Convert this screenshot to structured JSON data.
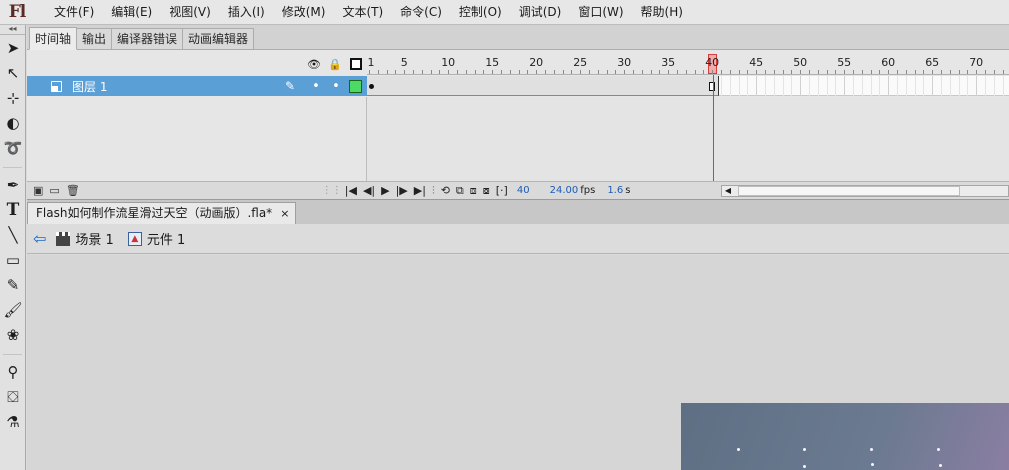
{
  "app": {
    "logo": "Fl"
  },
  "menu": [
    "文件(F)",
    "编辑(E)",
    "视图(V)",
    "插入(I)",
    "修改(M)",
    "文本(T)",
    "命令(C)",
    "控制(O)",
    "调试(D)",
    "窗口(W)",
    "帮助(H)"
  ],
  "toolbar": {
    "grip": "◂◂",
    "tools": [
      "selection-tool",
      "subselection-tool",
      "free-transform-tool",
      "3d-rotation-tool",
      "lasso-tool",
      "pen-tool",
      "text-tool",
      "line-tool",
      "rectangle-tool",
      "pencil-tool",
      "brush-tool",
      "deco-tool",
      "bone-tool",
      "paint-bucket-tool",
      "eyedropper-tool"
    ],
    "text_glyph": "T"
  },
  "timeline": {
    "tabs": [
      {
        "label": "时间轴",
        "active": true
      },
      {
        "label": "输出"
      },
      {
        "label": "编译器错误"
      },
      {
        "label": "动画编辑器"
      }
    ],
    "ruler": {
      "labels": [
        "1",
        "5",
        "10",
        "15",
        "20",
        "25",
        "30",
        "35",
        "45",
        "50",
        "55",
        "60",
        "65",
        "70"
      ],
      "current_frame": "40"
    },
    "layer": {
      "name": "图层 1",
      "color": "#4cd964",
      "selected": true,
      "tween_frames": 40
    },
    "controls": {
      "current_frame": "40",
      "fps": "24.00",
      "fps_unit": "fps",
      "elapsed": "1.6",
      "elapsed_unit": "s"
    }
  },
  "document": {
    "tab_title": "Flash如何制作流星滑过天空（动画版）.fla*",
    "close": "×"
  },
  "edit_bar": {
    "scene": "场景 1",
    "symbol": "元件 1"
  }
}
